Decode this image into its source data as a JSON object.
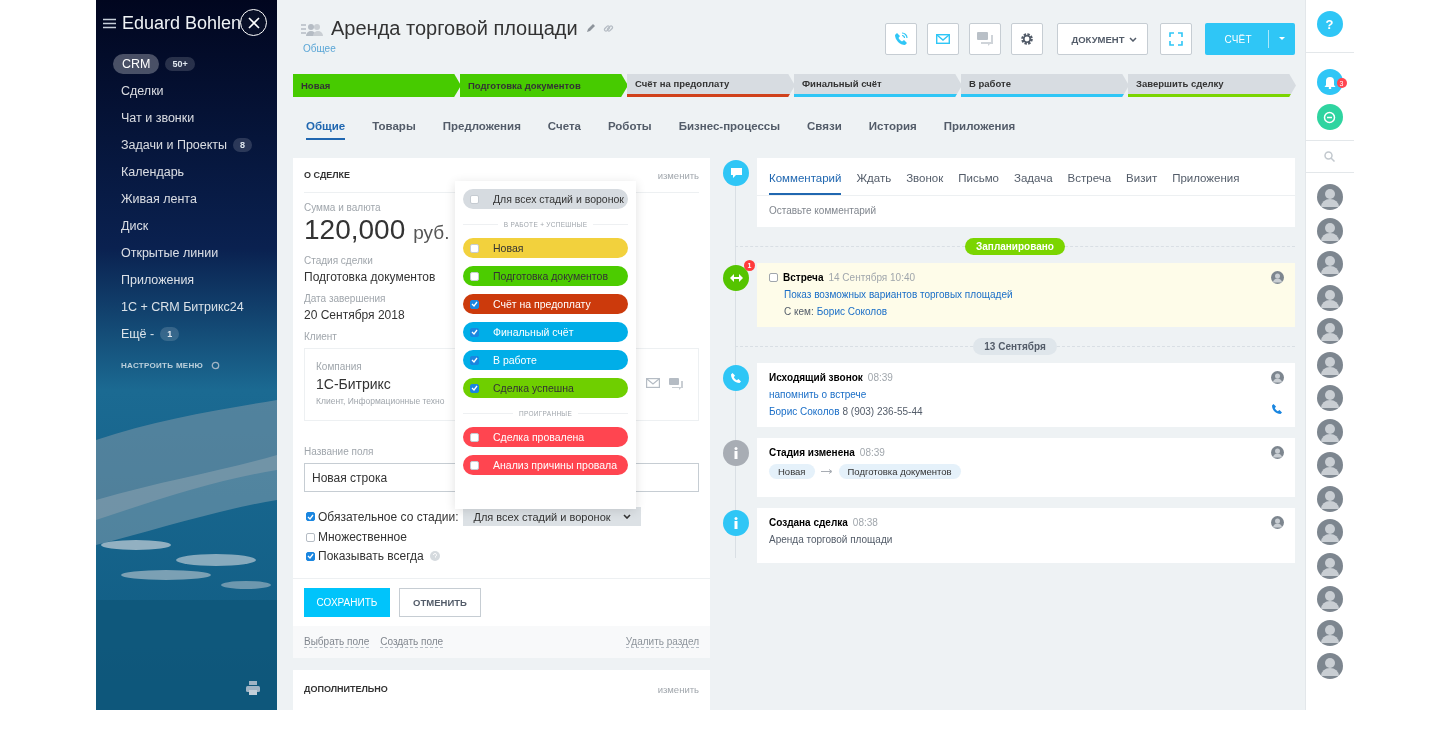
{
  "sidebar": {
    "title": "Eduard Bohlen",
    "items": [
      {
        "label": "CRM",
        "badge": "50+",
        "selected": true
      },
      {
        "label": "Сделки",
        "selected": false
      },
      {
        "label": "Чат и звонки",
        "selected": false
      },
      {
        "label": "Задачи и Проекты",
        "badge": "8",
        "selected": false
      },
      {
        "label": "Календарь",
        "selected": false
      },
      {
        "label": "Живая лента",
        "selected": false
      },
      {
        "label": "Диск",
        "selected": false
      },
      {
        "label": "Открытые линии",
        "selected": false
      },
      {
        "label": "Приложения",
        "selected": false
      },
      {
        "label": "1С + CRM Битрикс24",
        "selected": false
      },
      {
        "label": "Ещё -",
        "badge": "1",
        "selected": false
      }
    ],
    "settings_link": "НАСТРОИТЬ МЕНЮ"
  },
  "header": {
    "title": "Аренда торговой площади",
    "subtitle": "Общее",
    "document_button": "ДОКУМЕНТ",
    "invoice_button": "СЧЁТ"
  },
  "stages": [
    {
      "label": "Новая",
      "color": "#47cb00",
      "done": true
    },
    {
      "label": "Подготовка документов",
      "color": "#47cb00",
      "done": true
    },
    {
      "label": "Счёт на предоплату",
      "color": "#d0411b",
      "done": false
    },
    {
      "label": "Финальный счёт",
      "color": "#2fc6f6",
      "done": false
    },
    {
      "label": "В работе",
      "color": "#2fc6f6",
      "done": false
    },
    {
      "label": "Завершить сделку",
      "color": "#7bd500",
      "done": false
    }
  ],
  "tabs": [
    {
      "label": "Общие",
      "selected": true
    },
    {
      "label": "Товары",
      "selected": false
    },
    {
      "label": "Предложения",
      "selected": false
    },
    {
      "label": "Счета",
      "selected": false
    },
    {
      "label": "Роботы",
      "selected": false
    },
    {
      "label": "Бизнес-процессы",
      "selected": false
    },
    {
      "label": "Связи",
      "selected": false
    },
    {
      "label": "История",
      "selected": false
    },
    {
      "label": "Приложения",
      "selected": false
    }
  ],
  "deal_card": {
    "heading": "О СДЕЛКЕ",
    "edit_link": "изменить",
    "fields": [
      {
        "kind": "amount",
        "label": "Сумма и валюта",
        "value": "120,000",
        "unit": "руб."
      },
      {
        "kind": "text",
        "label": "Стадия сделки",
        "value": "Подготовка документов"
      },
      {
        "kind": "text",
        "label": "Дата завершения",
        "value": "20 Сентября 2018"
      }
    ],
    "client": {
      "label": "Клиент",
      "type_label": "Компания",
      "name": "1С-Битрикс",
      "description": "Клиент, Информационные техно"
    },
    "field_name_label": "Название поля",
    "field_name_value": "Новая строка",
    "options": [
      {
        "label": "Обязательное со стадии:",
        "checked": true,
        "kind": "stage_select",
        "select": "Для всех стадий и воронок"
      },
      {
        "label": "Множественное",
        "checked": false,
        "kind": "plain"
      },
      {
        "label": "Показывать всегда",
        "checked": true,
        "kind": "help"
      }
    ],
    "save_button": "СОХРАНИТЬ",
    "cancel_button": "ОТМЕНИТЬ",
    "links": [
      "Выбрать поле",
      "Создать поле"
    ],
    "delete_link": "Удалить раздел"
  },
  "extra_card": {
    "heading": "ДОПОЛНИТЕЛЬНО",
    "edit_link": "изменить"
  },
  "stage_dropdown": {
    "all_option": {
      "label": "Для всех стадий и воронок",
      "checked": false
    },
    "groups": [
      {
        "title": "В РАБОТЕ + УСПЕШНЫЕ",
        "items": [
          {
            "label": "Новая",
            "color": "#f2d13d",
            "checked": false
          },
          {
            "label": "Подготовка документов",
            "color": "#4ccc00",
            "checked": false
          },
          {
            "label": "Счёт на предоплату",
            "color": "#cc3a0c",
            "checked": true
          },
          {
            "label": "Финальный счёт",
            "color": "#00aee8",
            "checked": true
          },
          {
            "label": "В работе",
            "color": "#00aee8",
            "checked": true
          },
          {
            "label": "Сделка успешна",
            "color": "#6fcf00",
            "checked": true
          }
        ]
      },
      {
        "title": "ПРОИГРАННЫЕ",
        "items": [
          {
            "label": "Сделка провалена",
            "color": "#ff4550",
            "checked": false
          },
          {
            "label": "Анализ причины провала",
            "color": "#ff4550",
            "checked": false
          }
        ]
      }
    ]
  },
  "timeline": {
    "tabs": [
      {
        "label": "Комментарий",
        "selected": true
      },
      {
        "label": "Ждать",
        "selected": false
      },
      {
        "label": "Звонок",
        "selected": false
      },
      {
        "label": "Письмо",
        "selected": false
      },
      {
        "label": "Задача",
        "selected": false
      },
      {
        "label": "Встреча",
        "selected": false
      },
      {
        "label": "Визит",
        "selected": false
      },
      {
        "label": "Приложения",
        "selected": false
      }
    ],
    "comment_placeholder": "Оставьте комментарий",
    "items": [
      {
        "kind": "planned_divider",
        "label": "Запланировано"
      },
      {
        "kind": "meeting",
        "title": "Встреча",
        "time": "14 Сентября 10:40",
        "link": "Показ возможных вариантов торговых площадей",
        "with_label": "С кем:",
        "contact": "Борис Соколов",
        "badge": "1",
        "checked": false
      },
      {
        "kind": "date_divider",
        "label": "13 Сентября"
      },
      {
        "kind": "call",
        "title": "Исходящий звонок",
        "time": "08:39",
        "link": "напомнить о встрече",
        "contact": "Борис Соколов",
        "phone": "8 (903) 236-55-44"
      },
      {
        "kind": "stage_change",
        "title": "Стадия изменена",
        "time": "08:39",
        "from": "Новая",
        "to": "Подготовка документов"
      },
      {
        "kind": "created",
        "title": "Создана сделка",
        "time": "08:38",
        "text": "Аренда торговой площади"
      }
    ]
  },
  "right_bar": {
    "help_button": "?",
    "notifications_badge": "3"
  }
}
